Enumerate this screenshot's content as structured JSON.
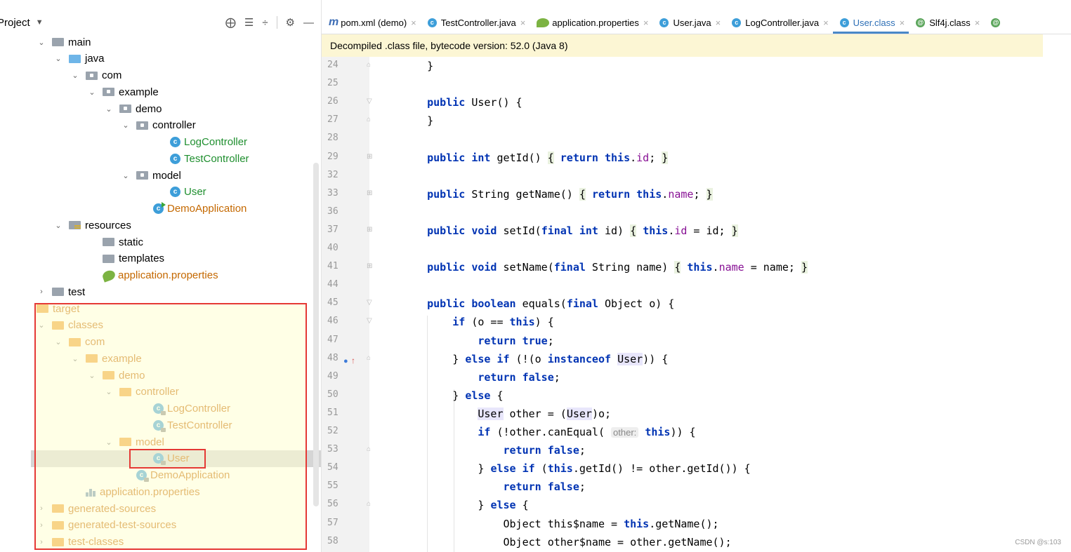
{
  "project": {
    "title": "Project",
    "tools": [
      "⨁",
      "☰",
      "÷",
      "⚙",
      "—"
    ]
  },
  "tree": [
    {
      "label": "main",
      "level": 0,
      "expanded": true,
      "icon": "folder-gray"
    },
    {
      "label": "java",
      "level": 1,
      "expanded": true,
      "icon": "folder-blue"
    },
    {
      "label": "com",
      "level": 2,
      "expanded": true,
      "icon": "package"
    },
    {
      "label": "example",
      "level": 3,
      "expanded": true,
      "icon": "package"
    },
    {
      "label": "demo",
      "level": 4,
      "expanded": true,
      "icon": "package"
    },
    {
      "label": "controller",
      "level": 5,
      "expanded": true,
      "icon": "package"
    },
    {
      "label": "LogController",
      "level": 7,
      "icon": "class",
      "color": "green"
    },
    {
      "label": "TestController",
      "level": 7,
      "icon": "class",
      "color": "green"
    },
    {
      "label": "model",
      "level": 5,
      "expanded": true,
      "icon": "package"
    },
    {
      "label": "User",
      "level": 7,
      "icon": "class",
      "color": "green"
    },
    {
      "label": "DemoApplication",
      "level": 6,
      "icon": "class-run",
      "color": "orange"
    },
    {
      "label": "resources",
      "level": 1,
      "expanded": true,
      "icon": "folder-res"
    },
    {
      "label": "static",
      "level": 3,
      "icon": "folder-gray"
    },
    {
      "label": "templates",
      "level": 3,
      "icon": "folder-gray"
    },
    {
      "label": "application.properties",
      "level": 3,
      "icon": "spring-leaf",
      "color": "orange"
    },
    {
      "label": "test",
      "level": 0,
      "expanded": false,
      "icon": "folder-gray"
    },
    {
      "label": "target",
      "level": -1,
      "icon": "folder-orange",
      "color": "orange"
    },
    {
      "label": "classes",
      "level": 0,
      "expanded": true,
      "icon": "folder-orange",
      "color": "orange"
    },
    {
      "label": "com",
      "level": 1,
      "expanded": true,
      "icon": "folder-orange",
      "color": "orange"
    },
    {
      "label": "example",
      "level": 2,
      "expanded": true,
      "icon": "folder-orange",
      "color": "orange"
    },
    {
      "label": "demo",
      "level": 3,
      "expanded": true,
      "icon": "folder-orange",
      "color": "orange"
    },
    {
      "label": "controller",
      "level": 4,
      "expanded": true,
      "icon": "folder-orange",
      "color": "orange"
    },
    {
      "label": "LogController",
      "level": 6,
      "icon": "class-lock",
      "color": "orange"
    },
    {
      "label": "TestController",
      "level": 6,
      "icon": "class-lock",
      "color": "orange"
    },
    {
      "label": "model",
      "level": 4,
      "expanded": true,
      "icon": "folder-orange",
      "color": "orange"
    },
    {
      "label": "User",
      "level": 6,
      "icon": "class-lock",
      "color": "orange",
      "selected": true
    },
    {
      "label": "DemoApplication",
      "level": 5,
      "icon": "class-lock",
      "color": "orange"
    },
    {
      "label": "application.properties",
      "level": 2,
      "icon": "properties",
      "color": "orange"
    },
    {
      "label": "generated-sources",
      "level": 0,
      "expanded": false,
      "icon": "folder-orange",
      "color": "orange"
    },
    {
      "label": "generated-test-sources",
      "level": 0,
      "expanded": false,
      "icon": "folder-orange",
      "color": "orange"
    },
    {
      "label": "test-classes",
      "level": 0,
      "expanded": false,
      "icon": "folder-orange",
      "color": "orange"
    }
  ],
  "tabs": [
    {
      "label": "pom.xml (demo)",
      "icon": "maven-icon"
    },
    {
      "label": "TestController.java",
      "icon": "class-icon"
    },
    {
      "label": "application.properties",
      "icon": "spring-leaf-icon"
    },
    {
      "label": "User.java",
      "icon": "class-icon"
    },
    {
      "label": "LogController.java",
      "icon": "class-icon"
    },
    {
      "label": "User.class",
      "icon": "class-icon",
      "active": true
    },
    {
      "label": "Slf4j.class",
      "icon": "annotation-icon"
    },
    {
      "label": "",
      "icon": "annotation-icon"
    }
  ],
  "banner": "Decompiled .class file, bytecode version: 52.0 (Java 8)",
  "line_numbers": [
    "24",
    "25",
    "26",
    "27",
    "28",
    "29",
    "32",
    "33",
    "36",
    "37",
    "40",
    "41",
    "44",
    "45",
    "46",
    "47",
    "48",
    "49",
    "50",
    "51",
    "52",
    "53",
    "54",
    "55",
    "56",
    "57",
    "58"
  ],
  "code": [
    "    }",
    "",
    "    public User() {",
    "    }",
    "",
    "    public int getId() { return this.id; }",
    "",
    "    public String getName() { return this.name; }",
    "",
    "    public void setId(final int id) { this.id = id; }",
    "",
    "    public void setName(final String name) { this.name = name; }",
    "",
    "    public boolean equals(final Object o) {",
    "        if (o == this) {",
    "            return true;",
    "        } else if (!(o instanceof User)) {",
    "            return false;",
    "        } else {",
    "            User other = (User)o;",
    "            if (!other.canEqual( other: this)) {",
    "                return false;",
    "            } else if (this.getId() != other.getId()) {",
    "                return false;",
    "            } else {",
    "                Object this$name = this.getName();",
    "                Object other$name = other.getName();"
  ],
  "watermark": "CSDN @s:103"
}
